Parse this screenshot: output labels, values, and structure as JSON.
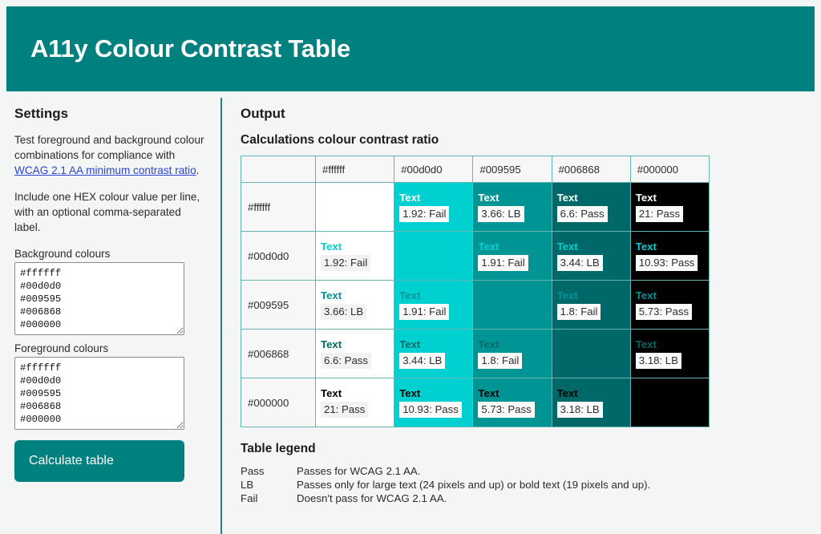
{
  "banner": {
    "title": "A11y Colour Contrast Table",
    "bg": "#00807f"
  },
  "settings": {
    "heading": "Settings",
    "intro_before": "Test foreground and background colour combinations for compliance with ",
    "intro_link": "WCAG 2.1 AA minimum contrast ratio",
    "intro_after": ".",
    "hint": "Include one HEX colour value per line, with an optional comma-separated label.",
    "background_label": "Background colours",
    "background_value": "#ffffff\n#00d0d0\n#009595\n#006868\n#000000",
    "foreground_label": "Foreground colours",
    "foreground_value": "#ffffff\n#00d0d0\n#009595\n#006868\n#000000",
    "calculate_label": "Calculate table"
  },
  "output": {
    "heading": "Output",
    "table_heading": "Calculations colour contrast ratio",
    "legend_heading": "Table legend"
  },
  "table": {
    "corner": "",
    "columns": [
      "#ffffff",
      "#00d0d0",
      "#009595",
      "#006868",
      "#000000"
    ],
    "rows": [
      "#ffffff",
      "#00d0d0",
      "#009595",
      "#006868",
      "#000000"
    ],
    "text_sample": "Text",
    "cells": [
      [
        {
          "ratio": "",
          "verdict": "",
          "label": "",
          "empty": true
        },
        {
          "ratio": "1.92",
          "verdict": "Fail",
          "label": "1.92: Fail",
          "empty": false
        },
        {
          "ratio": "3.66",
          "verdict": "LB",
          "label": "3.66: LB",
          "empty": false
        },
        {
          "ratio": "6.6",
          "verdict": "Pass",
          "label": "6.6: Pass",
          "empty": false
        },
        {
          "ratio": "21",
          "verdict": "Pass",
          "label": "21: Pass",
          "empty": false
        }
      ],
      [
        {
          "ratio": "1.92",
          "verdict": "Fail",
          "label": "1.92: Fail",
          "empty": false
        },
        {
          "ratio": "",
          "verdict": "",
          "label": "",
          "empty": true
        },
        {
          "ratio": "1.91",
          "verdict": "Fail",
          "label": "1.91: Fail",
          "empty": false
        },
        {
          "ratio": "3.44",
          "verdict": "LB",
          "label": "3.44: LB",
          "empty": false
        },
        {
          "ratio": "10.93",
          "verdict": "Pass",
          "label": "10.93: Pass",
          "empty": false
        }
      ],
      [
        {
          "ratio": "3.66",
          "verdict": "LB",
          "label": "3.66: LB",
          "empty": false
        },
        {
          "ratio": "1.91",
          "verdict": "Fail",
          "label": "1.91: Fail",
          "empty": false
        },
        {
          "ratio": "",
          "verdict": "",
          "label": "",
          "empty": true
        },
        {
          "ratio": "1.8",
          "verdict": "Fail",
          "label": "1.8: Fail",
          "empty": false
        },
        {
          "ratio": "5.73",
          "verdict": "Pass",
          "label": "5.73: Pass",
          "empty": false
        }
      ],
      [
        {
          "ratio": "6.6",
          "verdict": "Pass",
          "label": "6.6: Pass",
          "empty": false
        },
        {
          "ratio": "3.44",
          "verdict": "LB",
          "label": "3.44: LB",
          "empty": false
        },
        {
          "ratio": "1.8",
          "verdict": "Fail",
          "label": "1.8: Fail",
          "empty": false
        },
        {
          "ratio": "",
          "verdict": "",
          "label": "",
          "empty": true
        },
        {
          "ratio": "3.18",
          "verdict": "LB",
          "label": "3.18: LB",
          "empty": false
        }
      ],
      [
        {
          "ratio": "21",
          "verdict": "Pass",
          "label": "21: Pass",
          "empty": false
        },
        {
          "ratio": "10.93",
          "verdict": "Pass",
          "label": "10.93: Pass",
          "empty": false
        },
        {
          "ratio": "5.73",
          "verdict": "Pass",
          "label": "5.73: Pass",
          "empty": false
        },
        {
          "ratio": "3.18",
          "verdict": "LB",
          "label": "3.18: LB",
          "empty": false
        },
        {
          "ratio": "",
          "verdict": "",
          "label": "",
          "empty": true
        }
      ]
    ]
  },
  "legend": [
    {
      "key": "Pass",
      "desc": "Passes for WCAG 2.1 AA."
    },
    {
      "key": "LB",
      "desc": "Passes only for large text (24 pixels and up) or bold text (19 pixels and up)."
    },
    {
      "key": "Fail",
      "desc": "Doesn't pass for WCAG 2.1 AA."
    }
  ]
}
